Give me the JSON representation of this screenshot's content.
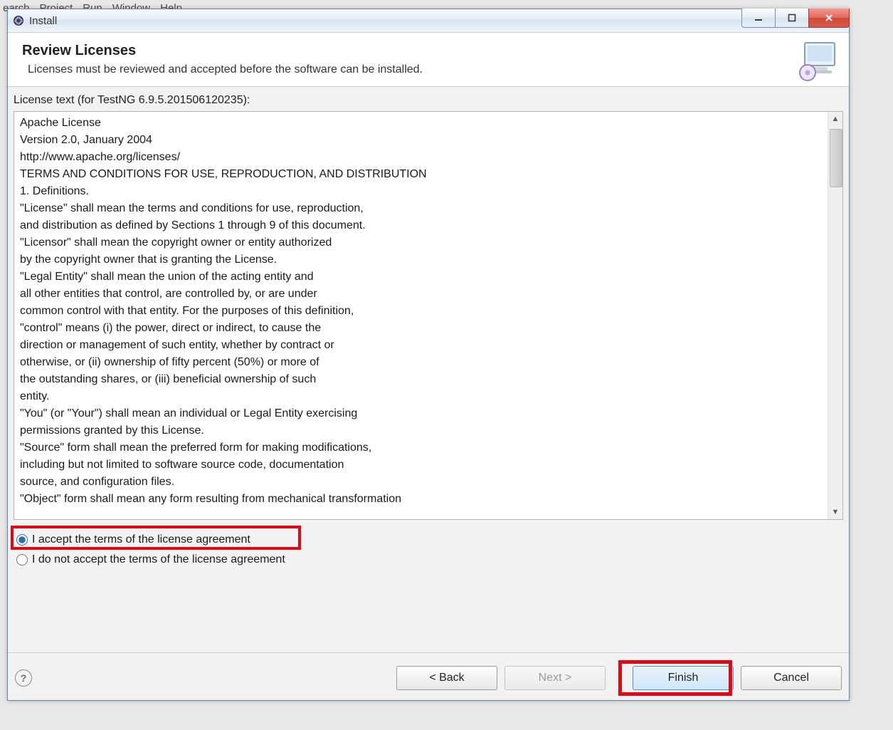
{
  "background_menus": [
    "earch",
    "Project",
    "Run",
    "Window",
    "Help"
  ],
  "window": {
    "title": "Install"
  },
  "banner": {
    "title": "Review Licenses",
    "subtitle": "Licenses must be reviewed and accepted before the software can be installed."
  },
  "license": {
    "header": "License text (for TestNG 6.9.5.201506120235):",
    "body": "Apache License\nVersion 2.0, January 2004\nhttp://www.apache.org/licenses/\nTERMS AND CONDITIONS FOR USE, REPRODUCTION, AND DISTRIBUTION\n1. Definitions.\n\"License\" shall mean the terms and conditions for use, reproduction,\nand distribution as defined by Sections 1 through 9 of this document.\n\"Licensor\" shall mean the copyright owner or entity authorized\nby the copyright owner that is granting the License.\n\"Legal Entity\" shall mean the union of the acting entity and\nall other entities that control, are controlled by, or are under\ncommon control with that entity. For the purposes of this definition,\n\"control\" means (i) the power, direct or indirect, to cause the\ndirection or management of such entity, whether by contract or\notherwise, or (ii) ownership of fifty percent (50%) or more of\nthe outstanding shares, or (iii) beneficial ownership of such\nentity.\n\"You\" (or \"Your\") shall mean an individual or Legal Entity exercising\npermissions granted by this License.\n\"Source\" form shall mean the preferred form for making modifications,\nincluding but not limited to software source code, documentation\nsource, and configuration files.\n\"Object\" form shall mean any form resulting from mechanical transformation"
  },
  "radios": {
    "accept": "I accept the terms of the license agreement",
    "decline": "I do not accept the terms of the license agreement",
    "selected": "accept"
  },
  "buttons": {
    "back": "< Back",
    "next": "Next >",
    "finish": "Finish",
    "cancel": "Cancel"
  }
}
